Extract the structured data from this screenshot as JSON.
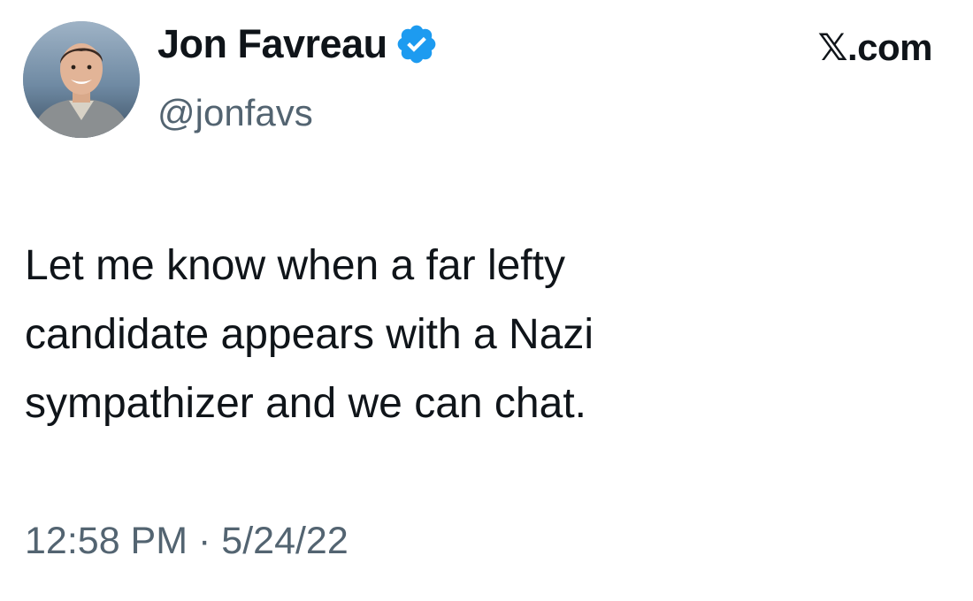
{
  "tweet": {
    "author": {
      "display_name": "Jon Favreau",
      "handle": "@jonfavs",
      "verified": true,
      "avatar_icon": "profile-photo"
    },
    "source_label": "𝕏.com",
    "text_lines": [
      "Let me know when a far lefty",
      "candidate appears with a Nazi",
      "sympathizer and we can chat."
    ],
    "time": "12:58 PM",
    "separator": "·",
    "date": "5/24/22"
  },
  "colors": {
    "text": "#0f1419",
    "secondary_text": "#536471",
    "verified_badge": "#1d9bf0",
    "background": "#ffffff"
  }
}
